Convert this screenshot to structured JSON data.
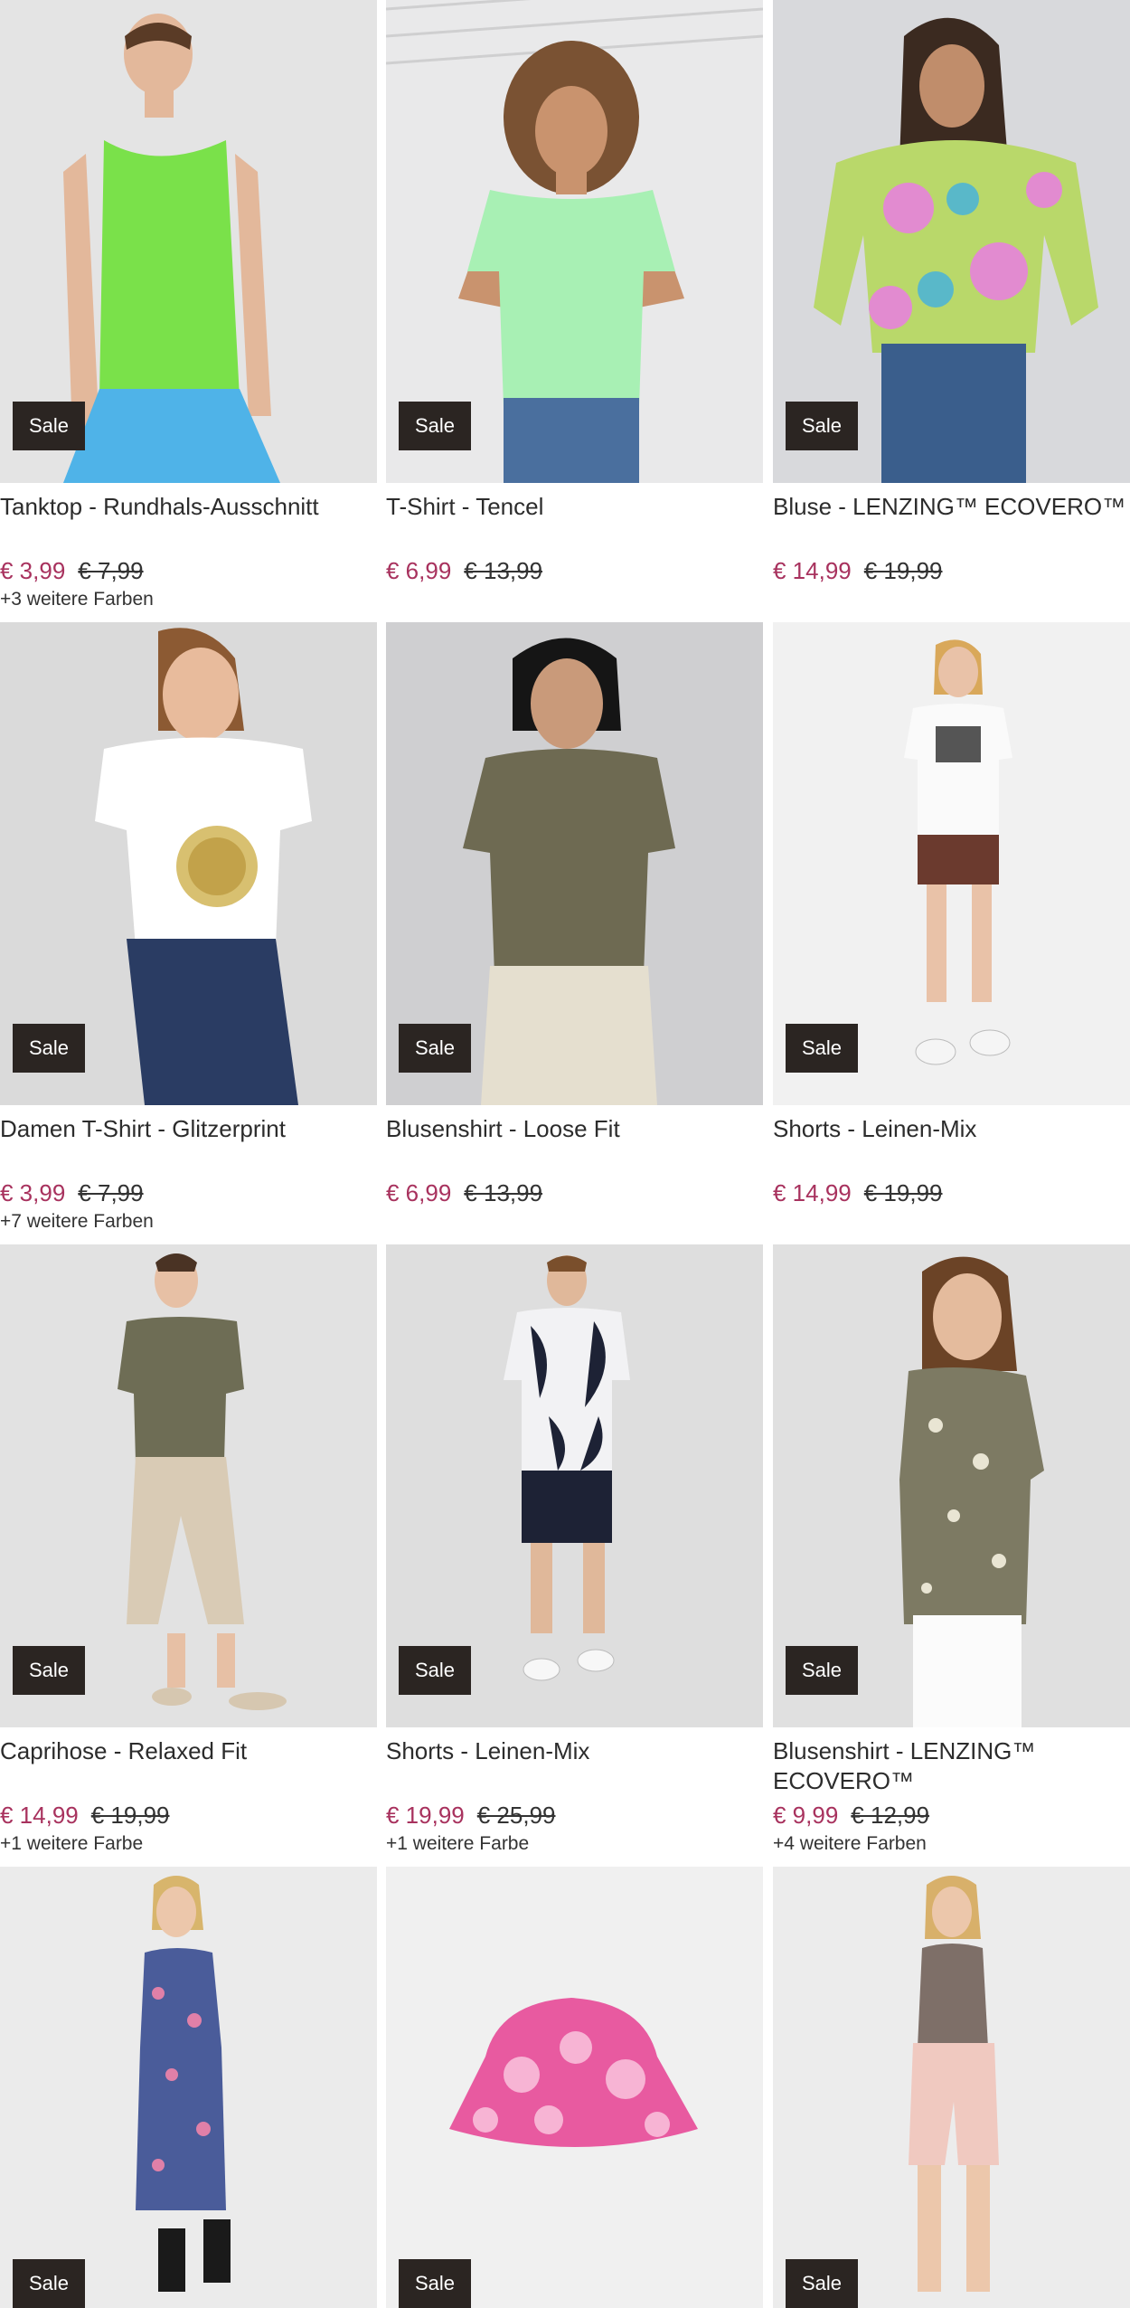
{
  "sale_label": "Sale",
  "products": [
    {
      "title": "Tanktop - Rundhals-Ausschnitt",
      "price": "€ 3,99",
      "old_price": "€ 7,99",
      "colors": "+3 weitere Farben",
      "bg": "#e4e4e4",
      "garment": "#7ae14a"
    },
    {
      "title": "T-Shirt - Tencel",
      "price": "€ 6,99",
      "old_price": "€ 13,99",
      "colors": "",
      "bg": "#e9e9ea",
      "garment": "#a8f0b4"
    },
    {
      "title": "Bluse - LENZING™ ECOVERO™",
      "price": "€ 14,99",
      "old_price": "€ 19,99",
      "colors": "",
      "bg": "#d8d9dc",
      "garment": "#b9d86a"
    },
    {
      "title": "Damen T-Shirt - Glitzerprint",
      "price": "€ 3,99",
      "old_price": "€ 7,99",
      "colors": "+7 weitere Farben",
      "bg": "#dadada",
      "garment": "#ffffff"
    },
    {
      "title": "Blusenshirt - Loose Fit",
      "price": "€ 6,99",
      "old_price": "€ 13,99",
      "colors": "",
      "bg": "#cfcfd1",
      "garment": "#6e6a52"
    },
    {
      "title": "Shorts - Leinen-Mix",
      "price": "€ 14,99",
      "old_price": "€ 19,99",
      "colors": "",
      "bg": "#f1f1f1",
      "garment": "#6b3a2e"
    },
    {
      "title": "Caprihose - Relaxed Fit",
      "price": "€ 14,99",
      "old_price": "€ 19,99",
      "colors": "+1 weitere Farbe",
      "bg": "#e2e2e2",
      "garment": "#d9cbb5"
    },
    {
      "title": "Shorts - Leinen-Mix",
      "price": "€ 19,99",
      "old_price": "€ 25,99",
      "colors": "+1 weitere Farbe",
      "bg": "#dedede",
      "garment": "#1d2235"
    },
    {
      "title": "Blusenshirt - LENZING™ ECOVERO™",
      "price": "€ 9,99",
      "old_price": "€ 12,99",
      "colors": "+4 weitere Farben",
      "bg": "#e0e0e0",
      "garment": "#7d7a63"
    },
    {
      "title": "",
      "price": "",
      "old_price": "",
      "colors": "",
      "bg": "#ebebeb",
      "garment": "#4a5c9a"
    },
    {
      "title": "",
      "price": "",
      "old_price": "",
      "colors": "",
      "bg": "#f0f0f0",
      "garment": "#e85aa0"
    },
    {
      "title": "",
      "price": "",
      "old_price": "",
      "colors": "",
      "bg": "#ececec",
      "garment": "#f0c9c0"
    }
  ]
}
